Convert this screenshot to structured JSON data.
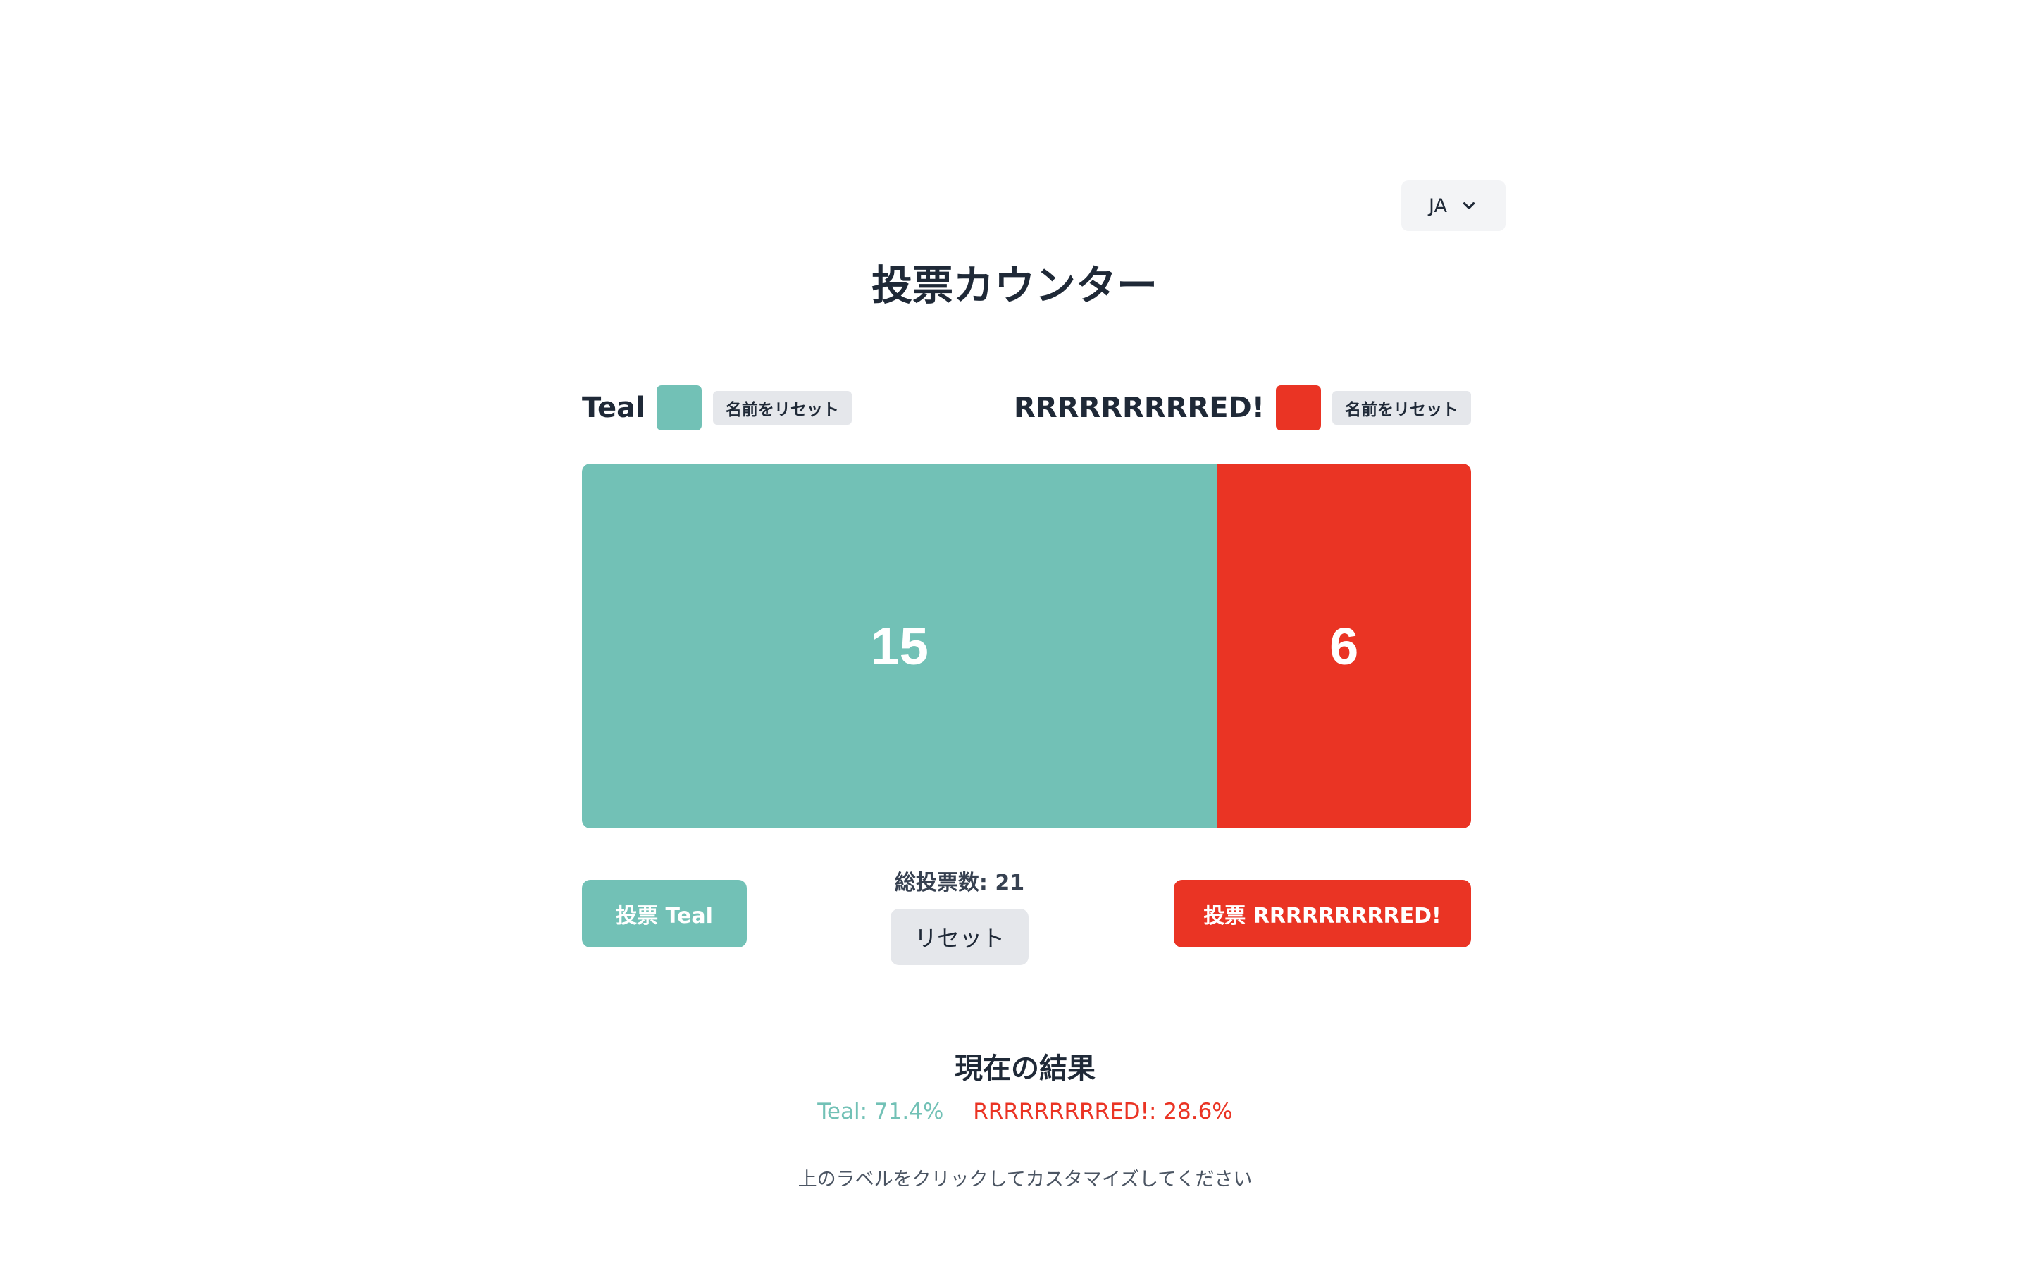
{
  "language": {
    "selected": "JA"
  },
  "title": "投票カウンター",
  "colors": {
    "teal": "#72c1b6",
    "red": "#ea3424",
    "gray_button": "#e5e7eb",
    "text": "#1f2937"
  },
  "left": {
    "name": "Teal",
    "color": "#72c1b6",
    "reset_name_label": "名前をリセット",
    "votes": 15,
    "votes_text": "15",
    "vote_button_label": "投票 Teal",
    "result_text": "Teal: 71.4%"
  },
  "right": {
    "name": "RRRRRRRRRED!",
    "color": "#ea3424",
    "reset_name_label": "名前をリセット",
    "votes": 6,
    "votes_text": "6",
    "vote_button_label": "投票 RRRRRRRRRED!",
    "result_text": "RRRRRRRRRED!: 28.6%"
  },
  "total_label": "総投票数: 21",
  "reset_label": "リセット",
  "results": {
    "title": "現在の結果"
  },
  "hint": "上のラベルをクリックしてカスタマイズしてください"
}
